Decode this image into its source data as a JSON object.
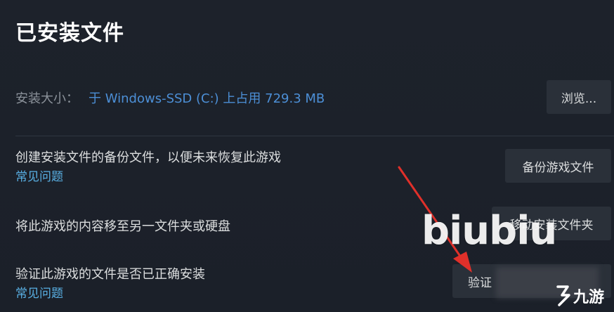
{
  "section": {
    "title": "已安装文件"
  },
  "install_size": {
    "label": "安装大小：",
    "value": "于 Windows-SSD (C:) 上占用 729.3 MB",
    "browse_label": "浏览..."
  },
  "rows": [
    {
      "text": "创建安装文件的备份文件，以便未来恢复此游戏",
      "link": "常见问题",
      "button": "备份游戏文件"
    },
    {
      "text": "将此游戏的内容移至另一文件夹或硬盘",
      "button": "移动安装文件夹"
    },
    {
      "text": "验证此游戏的文件是否已正确安装",
      "link": "常见问题",
      "button": "验证"
    }
  ],
  "watermark": {
    "text": "biubiu",
    "logo_text": "九游"
  },
  "colors": {
    "background": "#1b2028",
    "button": "#2a3039",
    "link": "#59b0e4",
    "size_value": "#4c8fd6",
    "annotation_arrow": "#e0302a"
  }
}
